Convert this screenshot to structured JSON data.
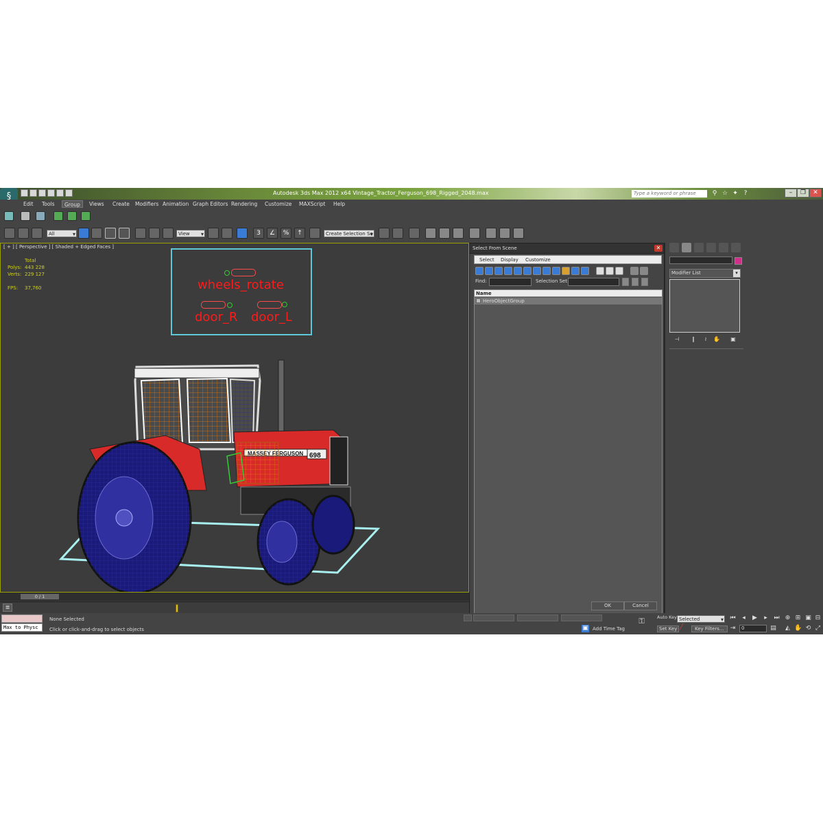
{
  "app": {
    "title": "Autodesk 3ds Max  2012 x64      Vintage_Tractor_Ferguson_698_Rigged_2048.max",
    "search_placeholder": "Type a keyword or phrase",
    "logo_glyph": "§"
  },
  "window_buttons": {
    "minimize": "–",
    "restore": "❐",
    "close": "✕"
  },
  "menu": [
    "Edit",
    "Tools",
    "Group",
    "Views",
    "Create",
    "Modifiers",
    "Animation",
    "Graph Editors",
    "Rendering",
    "Customize",
    "MAXScript",
    "Help"
  ],
  "menu_active_index": 2,
  "toolbar": {
    "selection_filter": "All",
    "reference_coord": "View",
    "named_selection": "Create Selection Se",
    "snap_labels": [
      "3",
      "∠",
      "%",
      "↑"
    ]
  },
  "viewport": {
    "label": "[ + ] [ Perspective ] [ Shaded + Edged Faces ]",
    "stats": {
      "total_label": "Total",
      "polys_label": "Polys:",
      "polys": "443 228",
      "verts_label": "Verts:",
      "verts": "229 127",
      "fps_label": "FPS:",
      "fps": "37,760"
    },
    "controls": [
      "wheels_rotate",
      "door_R",
      "door_L"
    ],
    "tractor_brand": "MASSEY FERGUSON",
    "tractor_model": "698"
  },
  "dialog": {
    "title": "Select From Scene",
    "close": "✕",
    "menu": [
      "Select",
      "Display",
      "Customize"
    ],
    "find_label": "Find:",
    "selection_set_label": "Selection Set:",
    "column_name": "Name",
    "rows": [
      "HeroObjectGroup"
    ],
    "ok": "OK",
    "cancel": "Cancel"
  },
  "command_panel": {
    "modifier_list": "Modifier List",
    "stack_tools": [
      "⊣",
      "∥",
      "≀",
      "✋",
      "▣"
    ]
  },
  "timeline": {
    "frame_label": "0 / 1",
    "track_icon": "≣"
  },
  "status": {
    "maxscript_text": "Max to Physc",
    "selection": "None Selected",
    "prompt": "Click or click-and-drag to select objects",
    "add_time_tag": "Add Time Tag",
    "set_key": "Set Key",
    "key_filters": "Key Filters...",
    "selected_dropdown": "Selected",
    "frame": "0",
    "auto_key": "Auto Key"
  },
  "colors": {
    "viewport_bg": "#3c3c3c",
    "control_panel_border": "#5fc8d8",
    "control_text": "#ff1a1a",
    "stats_text": "#d0d020",
    "tractor_red": "#d92a2a"
  },
  "icons": {
    "viewport_tractor": "tractor-wireframe-icon",
    "trackbar": "trackbar-toggle-icon"
  }
}
